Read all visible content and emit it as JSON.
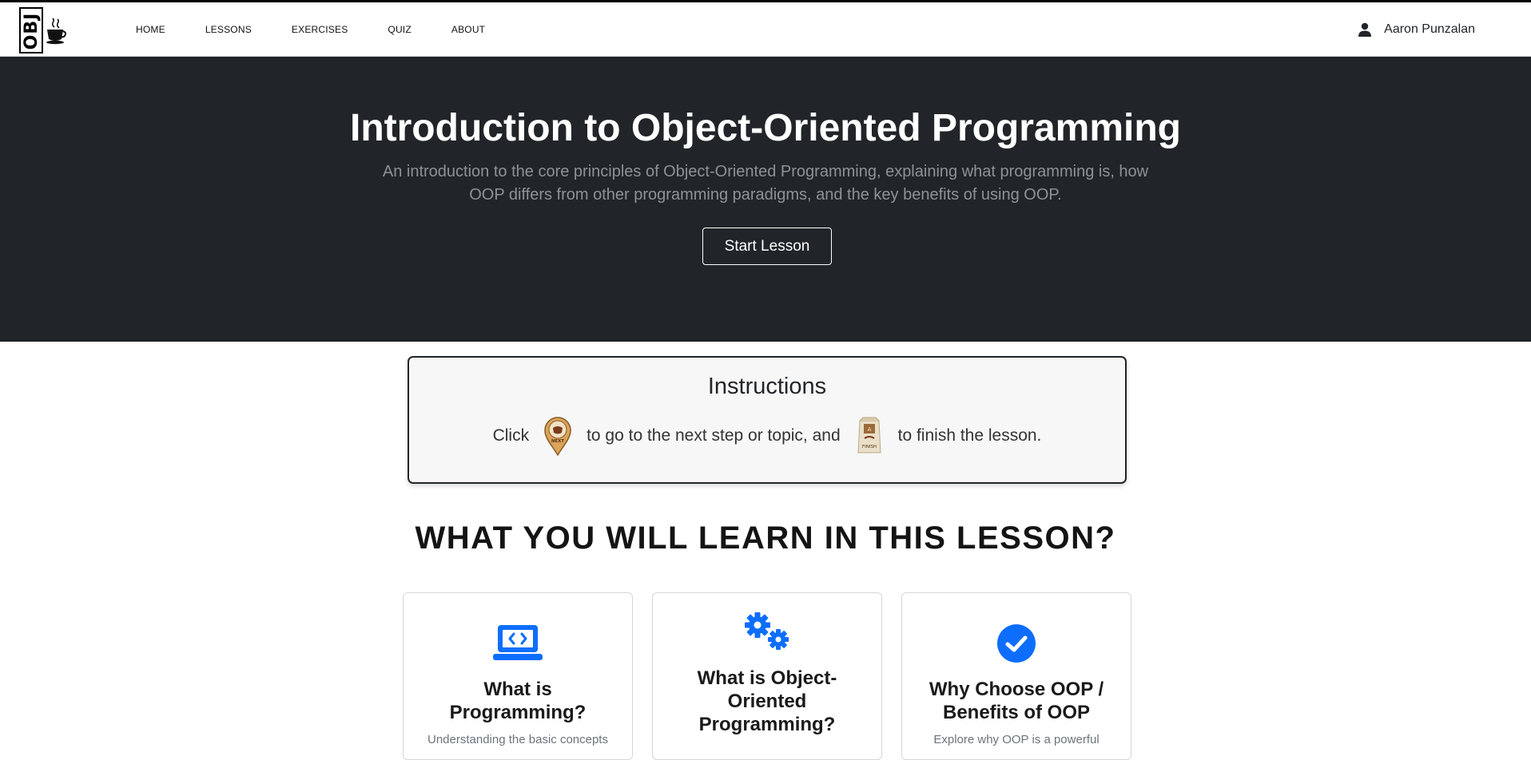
{
  "nav": {
    "logo_text": "OBJ",
    "links": [
      "HOME",
      "LESSONS",
      "EXERCISES",
      "QUIZ",
      "ABOUT"
    ],
    "user_name": "Aaron Punzalan"
  },
  "hero": {
    "title": "Introduction to Object-Oriented Programming",
    "subtitle": "An introduction to the core principles of Object-Oriented Programming, explaining what programming is, how OOP differs from other programming paradigms, and the key benefits of using OOP.",
    "button": "Start Lesson"
  },
  "instructions": {
    "title": "Instructions",
    "part1": "Click",
    "part2": "to go to the next step or topic, and",
    "part3": "to finish the lesson.",
    "next_icon_label": "NEXT",
    "finish_icon_label": "FINISH"
  },
  "learn": {
    "title": "WHAT YOU WILL LEARN IN THIS LESSON?",
    "cards": [
      {
        "icon": "laptop-code-icon",
        "title": "What is Programming?",
        "desc": "Understanding the basic concepts"
      },
      {
        "icon": "gears-icon",
        "title": "What is Object-Oriented Programming?",
        "desc": ""
      },
      {
        "icon": "check-circle-icon",
        "title": "Why Choose OOP / Benefits of OOP",
        "desc": "Explore why OOP is a powerful"
      }
    ]
  },
  "colors": {
    "hero_bg": "#212529",
    "accent_blue": "#0d6efd",
    "instructions_bg": "#f7f7f7"
  }
}
